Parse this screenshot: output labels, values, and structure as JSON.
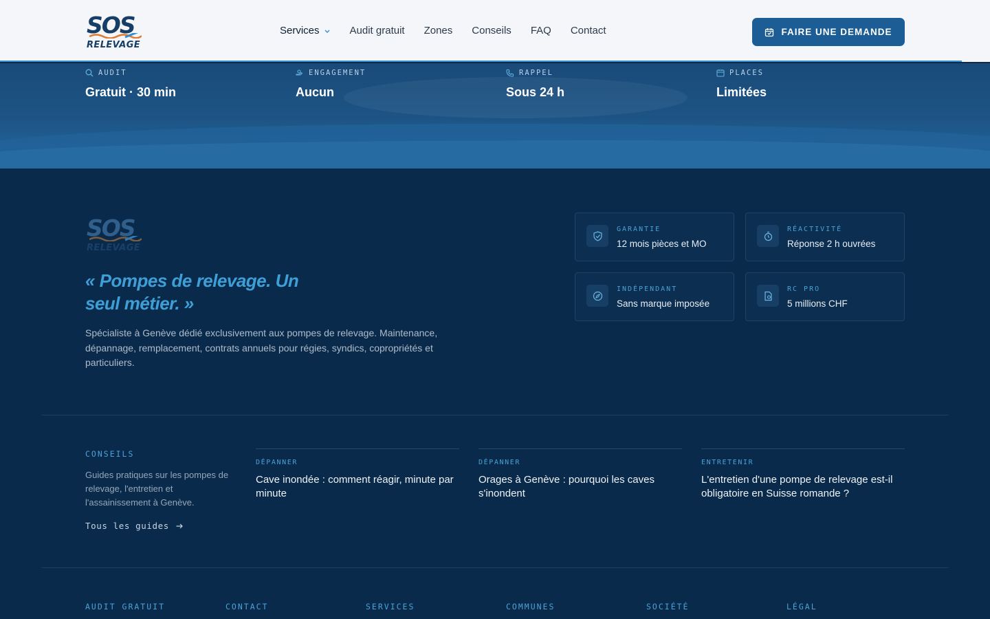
{
  "header": {
    "logo": {
      "top": "SOS",
      "bottom": "RELEVAGE"
    },
    "nav": [
      {
        "label": "Services"
      },
      {
        "label": "Audit gratuit"
      },
      {
        "label": "Zones"
      },
      {
        "label": "Conseils"
      },
      {
        "label": "FAQ"
      },
      {
        "label": "Contact"
      }
    ],
    "cta_label": "FAIRE UNE DEMANDE"
  },
  "stats": [
    {
      "label": "AUDIT",
      "value": "Gratuit · 30 min",
      "icon": "search-icon"
    },
    {
      "label": "ENGAGEMENT",
      "value": "Aucun",
      "icon": "hand-icon"
    },
    {
      "label": "RAPPEL",
      "value": "Sous 24 h",
      "icon": "phone-icon"
    },
    {
      "label": "PLACES",
      "value": "Limitées",
      "icon": "calendar-icon"
    }
  ],
  "footer": {
    "logo": {
      "top": "SOS",
      "bottom": "RELEVAGE"
    },
    "quote": "« Pompes de relevage. Un seul métier. »",
    "description": "Spécialiste à Genève dédié exclusivement aux pompes de relevage. Maintenance, dépannage, remplacement, contrats annuels pour régies, syndics, copropriétés et particuliers.",
    "cards": [
      {
        "label": "GARANTIE",
        "value": "12 mois pièces et MO",
        "icon": "shield-check-icon"
      },
      {
        "label": "RÉACTIVITÉ",
        "value": "Réponse 2 h ouvrées",
        "icon": "timer-icon"
      },
      {
        "label": "INDÉPENDANT",
        "value": "Sans marque imposée",
        "icon": "compass-icon"
      },
      {
        "label": "RC PRO",
        "value": "5 millions CHF",
        "icon": "document-icon"
      }
    ],
    "conseils": {
      "heading": "CONSEILS",
      "text": "Guides pratiques sur les pompes de relevage, l'entretien et l'assainissement à Genève.",
      "link": "Tous les guides"
    },
    "articles": [
      {
        "tag": "DÉPANNER",
        "title": "Cave inondée : comment réagir, minute par minute"
      },
      {
        "tag": "DÉPANNER",
        "title": "Orages à Genève : pourquoi les caves s'inondent"
      },
      {
        "tag": "ENTRETENIR",
        "title": "L'entretien d'une pompe de relevage est-il obligatoire en Suisse romande ?"
      }
    ],
    "columns": [
      "AUDIT GRATUIT",
      "CONTACT",
      "SERVICES",
      "COMMUNES",
      "SOCIÉTÉ",
      "LÉGAL"
    ]
  },
  "colors": {
    "brand": "#1c5d95",
    "accent": "#3e9fd6",
    "background": "#0a2a4b"
  }
}
